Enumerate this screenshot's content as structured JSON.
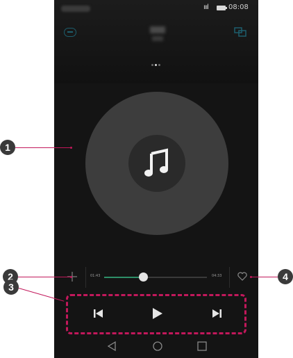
{
  "status_bar": {
    "signal_label": "ıııl",
    "time": "08:08"
  },
  "player": {
    "elapsed": "01:43",
    "total": "04:33",
    "progress": 0.38
  },
  "callouts": {
    "c1": "1",
    "c2": "2",
    "c3": "3",
    "c4": "4"
  },
  "colors": {
    "accent_progress": "#2e8f68",
    "callout_line": "#c2185b",
    "callout_badge": "#3a3a3a"
  },
  "icons": [
    "back-icon",
    "share-icon",
    "music-note-icon",
    "add-to-playlist-icon",
    "favorite-heart-icon",
    "previous-icon",
    "play-icon",
    "next-icon",
    "nav-back-icon",
    "nav-home-icon",
    "nav-recents-icon"
  ]
}
